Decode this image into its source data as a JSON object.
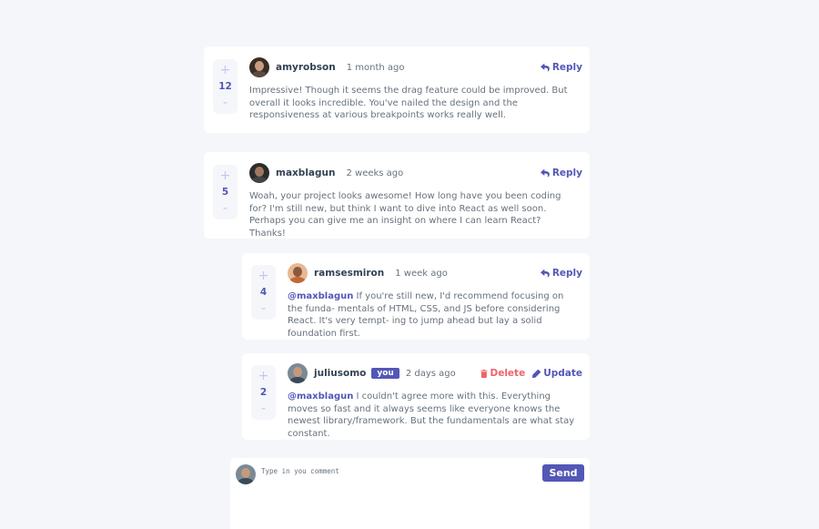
{
  "comments": [
    {
      "score": "12",
      "username": "amyrobson",
      "time": "1 month ago",
      "reply_label": "Reply",
      "content": "Impressive! Though it seems the drag feature could be improved. But overall it looks incredible. You've nailed the design and the responsiveness at various breakpoints works really well."
    },
    {
      "score": "5",
      "username": "maxblagun",
      "time": "2 weeks ago",
      "reply_label": "Reply",
      "content": "Woah, your project looks awesome! How long have you been coding for? I'm still new, but think I want to dive into React as well soon. Perhaps you can give me an insight on where I can learn React? Thanks!"
    }
  ],
  "replies": [
    {
      "score": "4",
      "username": "ramsesmiron",
      "time": "1 week ago",
      "reply_label": "Reply",
      "mention": "@maxblagun",
      "content": " If you're still new, I'd recommend focusing on the funda- mentals of HTML, CSS, and JS before considering React. It's very tempt- ing to jump ahead but lay a solid foundation first."
    },
    {
      "score": "2",
      "username": "juliusomo",
      "you_badge": "you",
      "time": "2 days ago",
      "delete_label": "Delete",
      "update_label": "Update",
      "mention": "@maxblagun",
      "content": " I couldn't agree more with this. Everything moves so fast and it always seems like everyone knows the newest library/framework. But the fundamentals are what stay constant."
    }
  ],
  "vote": {
    "plus": "+",
    "minus": "-"
  },
  "composer": {
    "placeholder": "Type in you comment",
    "send_label": "Send"
  },
  "colors": {
    "accent": "#5357b6",
    "danger": "#ed6368",
    "page_bg": "#f5f6fa",
    "card_bg": "#ffffff"
  },
  "icons": {
    "reply": "reply-arrow-icon",
    "delete": "trash-icon",
    "update": "pencil-icon"
  }
}
